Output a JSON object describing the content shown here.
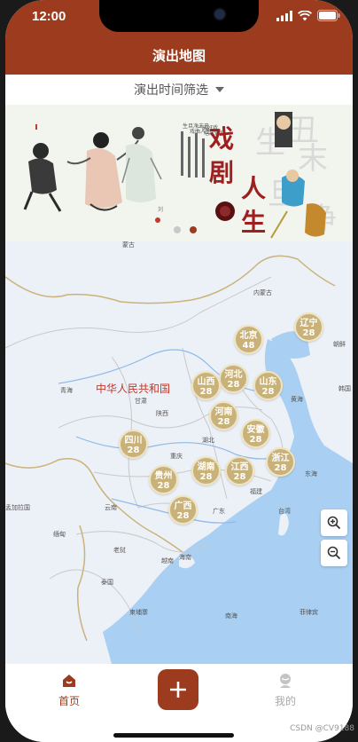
{
  "status_bar": {
    "time": "12:00"
  },
  "header": {
    "title": "演出地图"
  },
  "filter": {
    "label": "演出时间筛选"
  },
  "banner": {
    "headline_chars": [
      "戏",
      "剧",
      "人",
      "生"
    ],
    "dots": 2,
    "active_dot": 1
  },
  "map": {
    "country_label": "中华人民共和国",
    "place_labels": [
      "蒙古",
      "内蒙古",
      "甘肃",
      "陕西",
      "湖北",
      "重庆",
      "云南",
      "广东",
      "福建",
      "台湾",
      "海南",
      "缅甸",
      "老挝",
      "泰国",
      "柬埔寨",
      "越南",
      "南海",
      "黄海",
      "东海",
      "朝鲜",
      "韩国",
      "青海",
      "孟加拉国",
      "菲律宾"
    ],
    "markers": [
      {
        "name": "北京",
        "count": "48"
      },
      {
        "name": "辽宁",
        "count": "28"
      },
      {
        "name": "河北",
        "count": "28"
      },
      {
        "name": "山西",
        "count": "28"
      },
      {
        "name": "山东",
        "count": "28"
      },
      {
        "name": "河南",
        "count": "28"
      },
      {
        "name": "安徽",
        "count": "28"
      },
      {
        "name": "四川",
        "count": "28"
      },
      {
        "name": "浙江",
        "count": "28"
      },
      {
        "name": "湖南",
        "count": "28"
      },
      {
        "name": "江西",
        "count": "28"
      },
      {
        "name": "贵州",
        "count": "28"
      },
      {
        "name": "广西",
        "count": "28"
      }
    ]
  },
  "tabbar": {
    "home_label": "首页",
    "mine_label": "我的",
    "active_color": "#9c3b1e"
  },
  "watermark": "CSDN @CV9188"
}
